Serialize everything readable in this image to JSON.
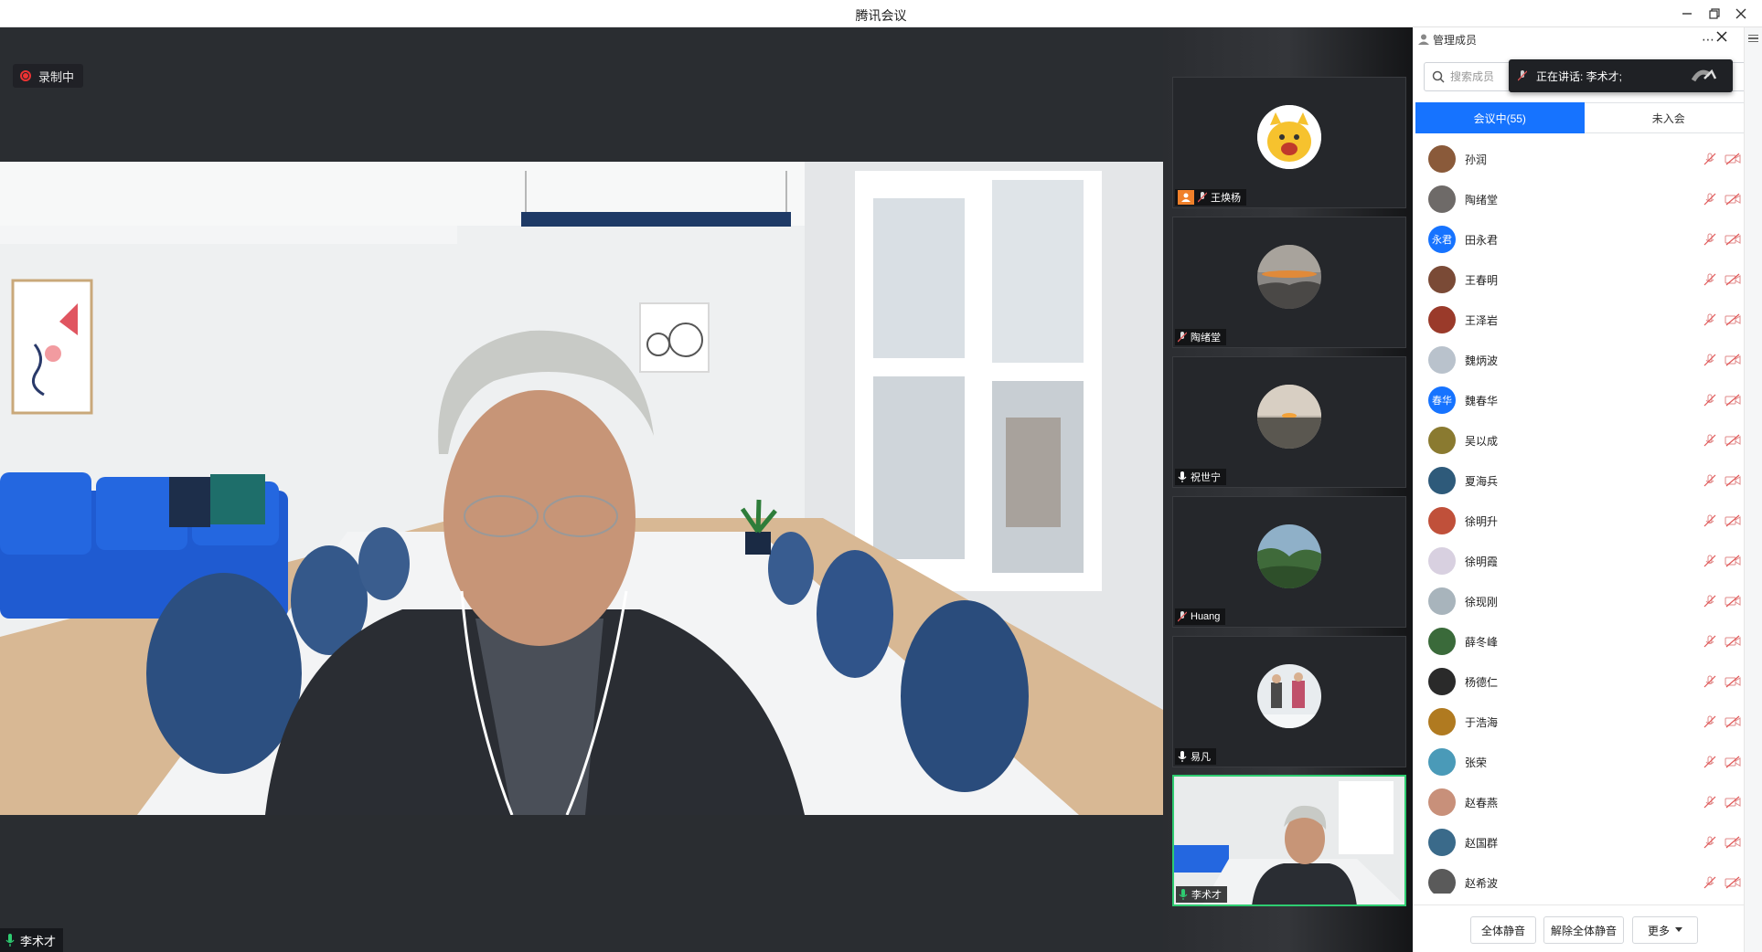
{
  "window": {
    "title": "腾讯会议"
  },
  "recording": {
    "label": "录制中"
  },
  "main": {
    "speaker_name": "李术才"
  },
  "thumbnails": [
    {
      "name": "王焕杨",
      "avatar": "tiger-avatar",
      "mic": "muted"
    },
    {
      "name": "陶绪堂",
      "avatar": "sunset-mountain",
      "mic": "muted"
    },
    {
      "name": "祝世宁",
      "avatar": "sea-sunset",
      "mic": "on"
    },
    {
      "name": "Huang",
      "avatar": "green-valley",
      "mic": "muted"
    },
    {
      "name": "易凡",
      "avatar": "snow-children",
      "mic": "on"
    },
    {
      "name": "李术才",
      "avatar": "video",
      "mic": "active"
    }
  ],
  "panel": {
    "title": "管理成员",
    "search_placeholder": "搜索成员",
    "speaking_text": "正在讲话: 李术才;",
    "tabs": [
      {
        "label": "会议中(55)"
      },
      {
        "label": "未入会"
      }
    ],
    "members": [
      {
        "name": "孙润",
        "avatar_color": "#8a5a3a",
        "initials": ""
      },
      {
        "name": "陶绪堂",
        "avatar_color": "#6e6a68",
        "initials": ""
      },
      {
        "name": "田永君",
        "avatar_color": "#1673ff",
        "initials": "永君"
      },
      {
        "name": "王春明",
        "avatar_color": "#7a4a36",
        "initials": ""
      },
      {
        "name": "王泽岩",
        "avatar_color": "#9a3a2a",
        "initials": ""
      },
      {
        "name": "魏炳波",
        "avatar_color": "#b9c2cc",
        "initials": ""
      },
      {
        "name": "魏春华",
        "avatar_color": "#1673ff",
        "initials": "春华"
      },
      {
        "name": "吴以成",
        "avatar_color": "#8a7a30",
        "initials": ""
      },
      {
        "name": "夏海兵",
        "avatar_color": "#2e5a7a",
        "initials": ""
      },
      {
        "name": "徐明升",
        "avatar_color": "#c0503a",
        "initials": ""
      },
      {
        "name": "徐明霞",
        "avatar_color": "#d8d0e0",
        "initials": ""
      },
      {
        "name": "徐现刚",
        "avatar_color": "#a8b4bc",
        "initials": ""
      },
      {
        "name": "薛冬峰",
        "avatar_color": "#3a6a3a",
        "initials": ""
      },
      {
        "name": "杨德仁",
        "avatar_color": "#2a2a2a",
        "initials": ""
      },
      {
        "name": "于浩海",
        "avatar_color": "#b07a20",
        "initials": ""
      },
      {
        "name": "张荣",
        "avatar_color": "#4a9ab8",
        "initials": ""
      },
      {
        "name": "赵春燕",
        "avatar_color": "#c8907a",
        "initials": ""
      },
      {
        "name": "赵国群",
        "avatar_color": "#3a6a8a",
        "initials": ""
      },
      {
        "name": "赵希波",
        "avatar_color": "#5a5a5a",
        "initials": ""
      }
    ],
    "footer": {
      "mute_all": "全体静音",
      "unmute_all": "解除全体静音",
      "more": "更多"
    }
  },
  "colors": {
    "accent": "#1673ff",
    "active_border": "#2ecc71",
    "muted_icon": "#e05555",
    "recording": "#e33333"
  }
}
